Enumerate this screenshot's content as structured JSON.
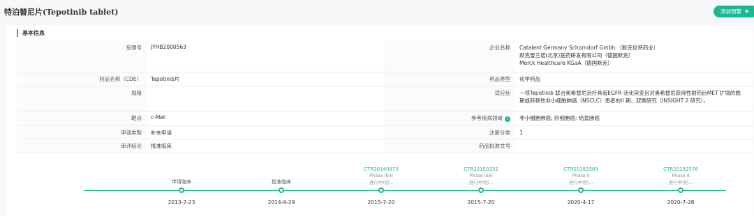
{
  "header": {
    "title": "特泊替尼片(Tepotinib tablet)",
    "alert_button": "添加预警",
    "alert_plus": "+"
  },
  "section": {
    "title": "基本信息"
  },
  "info": {
    "acceptance_no_label": "受理号",
    "acceptance_no": "JYHB2000563",
    "company_label": "企业名称",
    "company_lines": [
      "Catalent Germany Schorndorf Gmbh.（默克伦特药业）",
      "默克雪兰诺(北京)医药研发有限公司（德国默克）",
      "Merck Healthcare KGaA（德国默克）"
    ],
    "drug_name_label": "药品名称（CDE）",
    "drug_name": "Tepotinib片",
    "drug_type_label": "药品类型",
    "drug_type": "化学药品",
    "spec_label": "规格",
    "spec": "",
    "indication_label": "适应症",
    "indication_lines": [
      "一项Tepotinib 联合奥希替尼治疗具有EGFR 活化突变且对奥希替尼获得性耐药后MET 扩增的晚",
      "期或转移性非小细胞肺癌（NSCLC）患者的II 期、双臂研究（INSIGHT 2 研究）。"
    ],
    "target_label": "靶点",
    "target": "c-Met",
    "disease_area_label": "参考疾病领域",
    "disease_area_info": "i",
    "disease_area": "非小细胞肺癌; 肝细胞癌; 结直肠癌",
    "application_type_label": "申请类型",
    "application_type": "补充申请",
    "registration_class_label": "注册分类",
    "registration_class": "1",
    "review_conclusion_label": "审评结论",
    "review_conclusion": "批准临床",
    "approval_no_label": "药品批准文号",
    "approval_no": ""
  },
  "timeline": [
    {
      "trial": "",
      "phase": "",
      "status": "",
      "event": "申请临床",
      "date": "2013-7-23"
    },
    {
      "trial": "",
      "phase": "",
      "status": "",
      "event": "批准临床",
      "date": "2014-9-29"
    },
    {
      "trial": "CTR20140873",
      "phase": "Phase Ib/II",
      "status": "进行中(招...",
      "event": "",
      "date": "2015-7-20"
    },
    {
      "trial": "CTR20150252",
      "phase": "Phase Ib/II",
      "status": "进行中(招...",
      "event": "",
      "date": "2015-7-20"
    },
    {
      "trial": "CTR20192589",
      "phase": "Phase II",
      "status": "进行中(招...",
      "event": "",
      "date": "2020-4-17"
    },
    {
      "trial": "CTR20192576",
      "phase": "Phase II",
      "status": "进行中(招...",
      "event": "",
      "date": "2020-7-28"
    }
  ],
  "colors": {
    "accent": "#1bb78f",
    "background": "#f7f8fa",
    "border": "#eceef1"
  },
  "icons": {
    "info": "info-circle-icon",
    "plus": "plus-icon"
  }
}
